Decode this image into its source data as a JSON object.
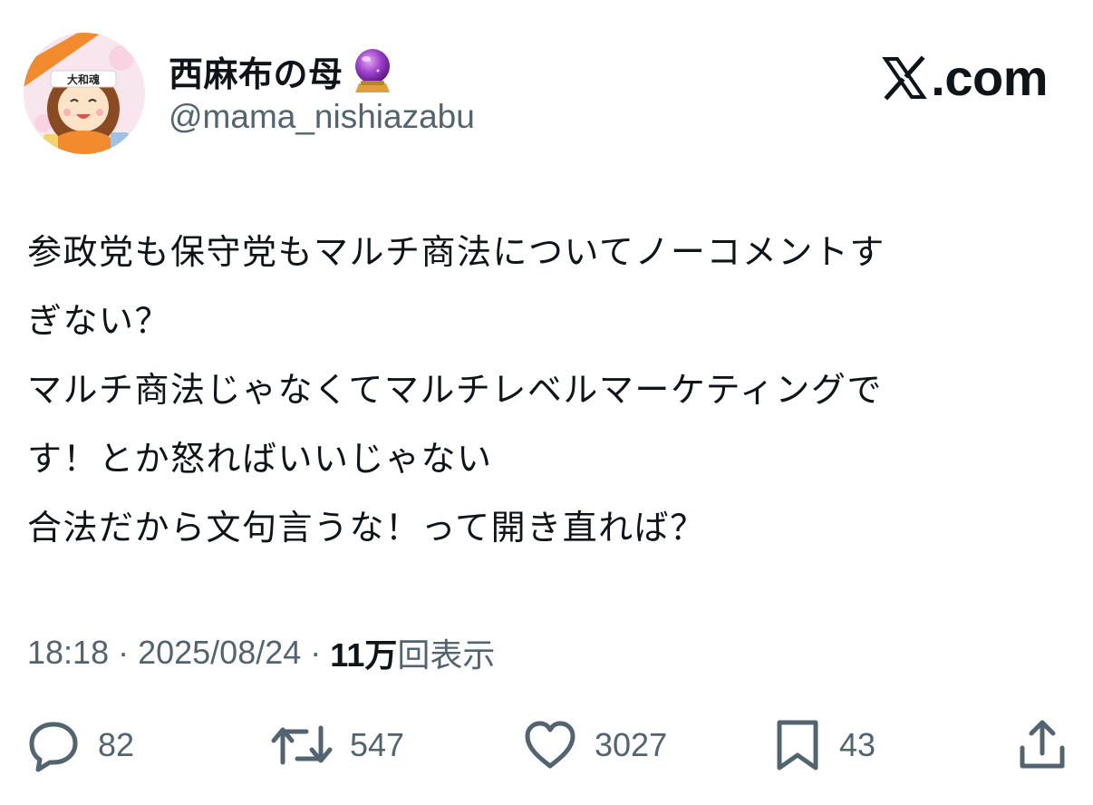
{
  "author": {
    "display_name": "西麻布の母",
    "handle": "@mama_nishiazabu",
    "badge_icon": "crystal-ball-icon",
    "avatar_headband_text": "大和魂"
  },
  "brand": {
    "text": ".com",
    "logo_icon": "x-logo-icon"
  },
  "tweet": {
    "lines": [
      "参政党も保守党もマルチ商法についてノーコメントす",
      "ぎない？",
      "マルチ商法じゃなくてマルチレベルマーケティングで",
      "す！とか怒ればいいじゃない",
      "合法だから文句言うな！って開き直れば？"
    ]
  },
  "meta": {
    "time": "18:18",
    "separator": "·",
    "date": "2025/08/24",
    "views_count": "11万",
    "views_label": "回表示"
  },
  "actions": {
    "reply": {
      "icon": "reply-icon",
      "count": "82"
    },
    "repost": {
      "icon": "repost-icon",
      "count": "547"
    },
    "like": {
      "icon": "heart-icon",
      "count": "3027"
    },
    "bookmark": {
      "icon": "bookmark-icon",
      "count": "43"
    },
    "share": {
      "icon": "share-icon"
    }
  },
  "colors": {
    "text_primary": "#0f1419",
    "text_secondary": "#536471",
    "background": "#ffffff",
    "avatar_accent": "#f28a2e"
  }
}
